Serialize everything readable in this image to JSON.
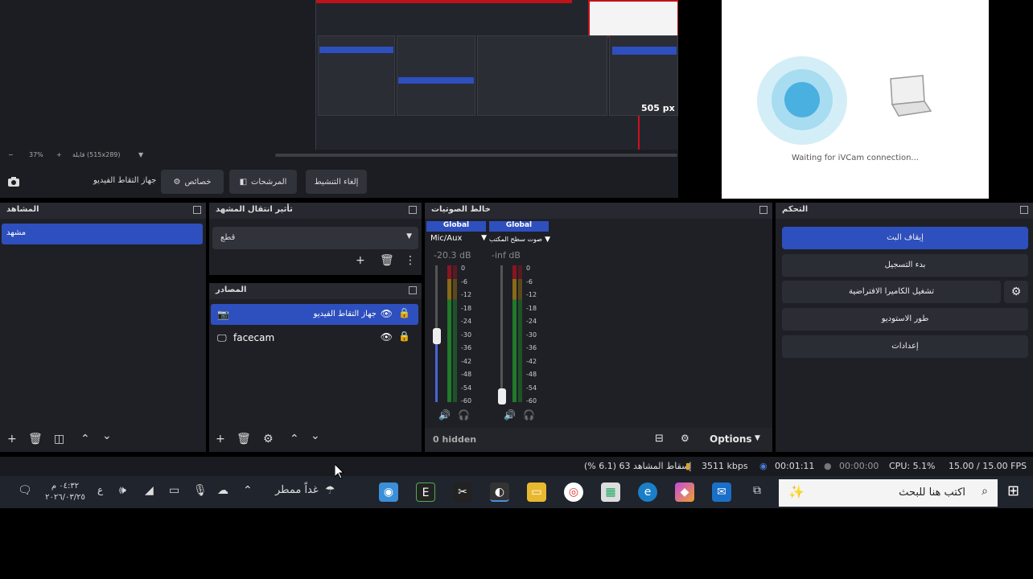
{
  "preview": {
    "size_label": "505 px",
    "zoom": "37%",
    "canvas_info": "قابلة (515x289)",
    "ivcam_status": "Waiting for iVCam connection..."
  },
  "toolbar": {
    "source_name": "جهاز التقاط الفيديو",
    "properties": "خصائص",
    "filters": "المرشحات",
    "deactivate": "إلغاء التنشيط"
  },
  "scenes": {
    "title": "المشاهد",
    "items": [
      "مشهد"
    ]
  },
  "transitions": {
    "title": "تأثير انتقال المشهد",
    "selected": "قطع"
  },
  "sources": {
    "title": "المصادر",
    "items": [
      {
        "name": "جهاز التقاط الفيديو",
        "icon": "camera-icon"
      },
      {
        "name": "facecam",
        "icon": "monitor-icon"
      }
    ]
  },
  "mixer": {
    "title": "خالط الصوتيات",
    "channels": [
      {
        "tag": "Global",
        "name": "Mic/Aux",
        "db": "-20.3 dB",
        "level": 0.77
      },
      {
        "tag": "Global",
        "name": "صوت سطح المكتب",
        "db": "-inf dB",
        "level": 0.03
      }
    ],
    "ticks": [
      "0",
      "-6",
      "-12",
      "-18",
      "-24",
      "-30",
      "-36",
      "-42",
      "-48",
      "-54",
      "-60"
    ],
    "hidden": "0 hidden",
    "options": "Options"
  },
  "controls": {
    "title": "التحكم",
    "stop_stream": "إيقاف البث",
    "start_recording": "بدء التسجيل",
    "virtual_camera": "تشغيل الكاميرا الافتراضية",
    "studio_mode": "طور الاستوديو",
    "settings": "إعدادات"
  },
  "status": {
    "dropped": "إسقاط المشاهد 63 (6.1 %)",
    "bitrate": "3511 kbps",
    "stream_time": "00:01:11",
    "rec_time": "00:00:00",
    "cpu": "CPU: 5.1%",
    "fps": "15.00 / 15.00 FPS"
  },
  "taskbar": {
    "search_placeholder": "اكتب هنا للبحث",
    "weather": "غداً ممطر",
    "time": "٠٤:٣٢ م",
    "date": "٢٠٢٦/٠٣/٢٥",
    "lang": "ع"
  },
  "colors": {
    "accent": "#2e4fbe",
    "panel": "#1f2026",
    "record_red": "#c0121a"
  }
}
